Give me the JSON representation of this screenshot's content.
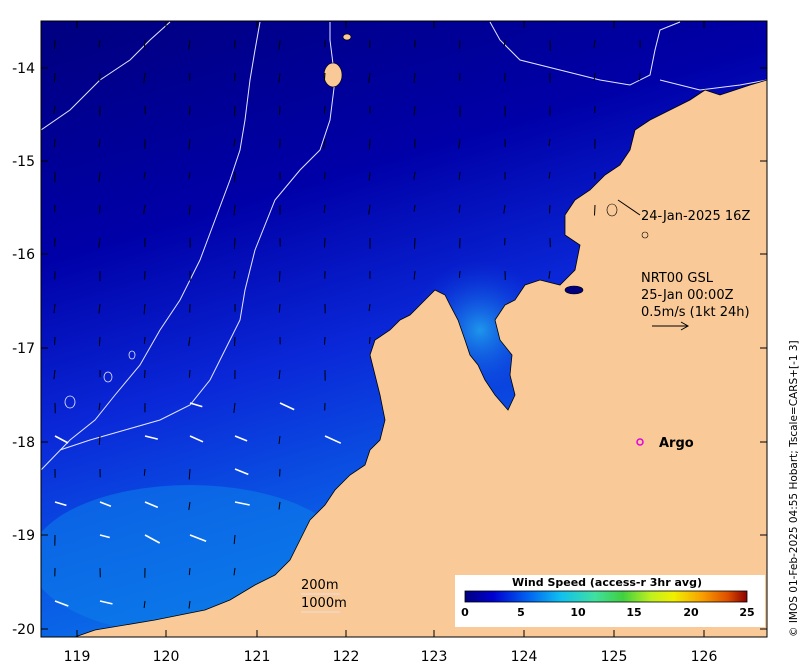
{
  "map": {
    "x_ticks": [
      "119",
      "120",
      "121",
      "122",
      "123",
      "124",
      "125",
      "126"
    ],
    "y_ticks": [
      "-14",
      "-15",
      "-16",
      "-17",
      "-18",
      "-19",
      "-20"
    ],
    "x_range": [
      118.6,
      126.7
    ],
    "y_range": [
      -20.2,
      -13.5
    ],
    "ocean_field": "wind speed",
    "land_color": "#f9ca97",
    "ocean_color_low": "#00007f",
    "ocean_color_high": "#0c8fec"
  },
  "annotations": {
    "track_time": "24-Jan-2025 16Z",
    "product": "NRT00 GSL",
    "map_time": "25-Jan 00:00Z",
    "scale_text": "0.5m/s (1kt 24h)",
    "argo_label": "Argo",
    "contour_200": "200m",
    "contour_1000": "1000m"
  },
  "colorbar": {
    "title": "Wind Speed (access-r 3hr avg)",
    "ticks": [
      "0",
      "5",
      "10",
      "15",
      "20",
      "25"
    ],
    "colors": [
      "#00007f",
      "#0000c8",
      "#0a30e8",
      "#0a7cf0",
      "#10c0f0",
      "#30e8c8",
      "#40e040",
      "#a8f020",
      "#f0f000",
      "#f8c000",
      "#f08000",
      "#d84000",
      "#8b0000"
    ]
  },
  "credit": "© IMOS 01-Feb-2025 04:55 Hobart; Tscale=CARS+[-1 3]",
  "chart_data": {
    "type": "heatmap",
    "xlabel": "",
    "ylabel": "",
    "xlim": [
      118.6,
      126.7
    ],
    "ylim": [
      -20.2,
      -13.5
    ],
    "legend_label": "Wind Speed (access-r 3hr avg)",
    "color_range": [
      0,
      25
    ],
    "argo_float": {
      "lon": 125.25,
      "lat": -18.0,
      "label": "Argo"
    }
  }
}
